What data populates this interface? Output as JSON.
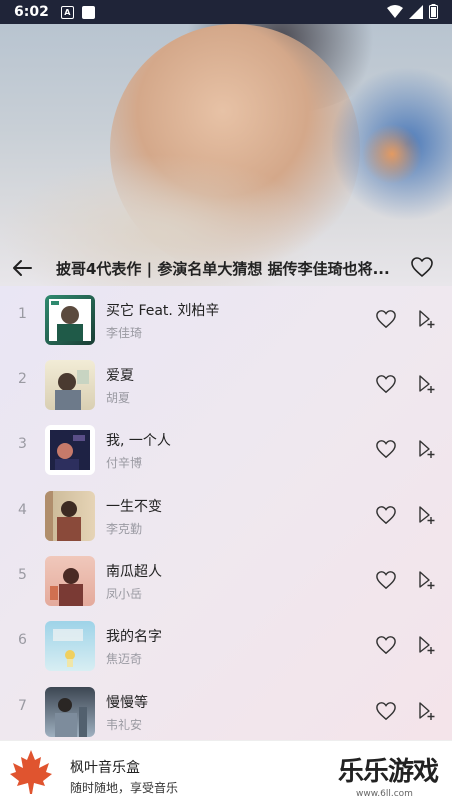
{
  "status_bar": {
    "time": "6:02",
    "a_icon": "A"
  },
  "header": {
    "title": "披哥4代表作 | 参演名单大猜想 据传李佳琦也将..."
  },
  "songs": [
    {
      "index": "1",
      "title": "买它 Feat. 刘柏辛",
      "artist": "李佳琦",
      "cover_colors": [
        "#1a3d34",
        "#2f8a6f"
      ]
    },
    {
      "index": "2",
      "title": "爱夏",
      "artist": "胡夏",
      "cover_colors": [
        "#e9e2c9",
        "#7a6a58"
      ]
    },
    {
      "index": "3",
      "title": "我, 一个人",
      "artist": "付辛博",
      "cover_colors": [
        "#1e2244",
        "#5a4e88"
      ]
    },
    {
      "index": "4",
      "title": "一生不变",
      "artist": "李克勤",
      "cover_colors": [
        "#c9b896",
        "#8a4a3a"
      ]
    },
    {
      "index": "5",
      "title": "南瓜超人",
      "artist": "凤小岳",
      "cover_colors": [
        "#f0c8bb",
        "#7a3a34"
      ]
    },
    {
      "index": "6",
      "title": "我的名字",
      "artist": "焦迈奇",
      "cover_colors": [
        "#9ed3e8",
        "#f0e6a8"
      ]
    },
    {
      "index": "7",
      "title": "慢慢等",
      "artist": "韦礼安",
      "cover_colors": [
        "#3c4652",
        "#9fb0c0"
      ]
    }
  ],
  "bottom_bar": {
    "app_name": "枫叶音乐盒",
    "slogan": "随时随地，享受音乐",
    "watermark": "乐乐游戏",
    "watermark_url": "www.6ll.com"
  },
  "colors": {
    "accent_leaf": "#e0542f",
    "text_primary": "#222222",
    "text_secondary": "#9a9aa2"
  }
}
